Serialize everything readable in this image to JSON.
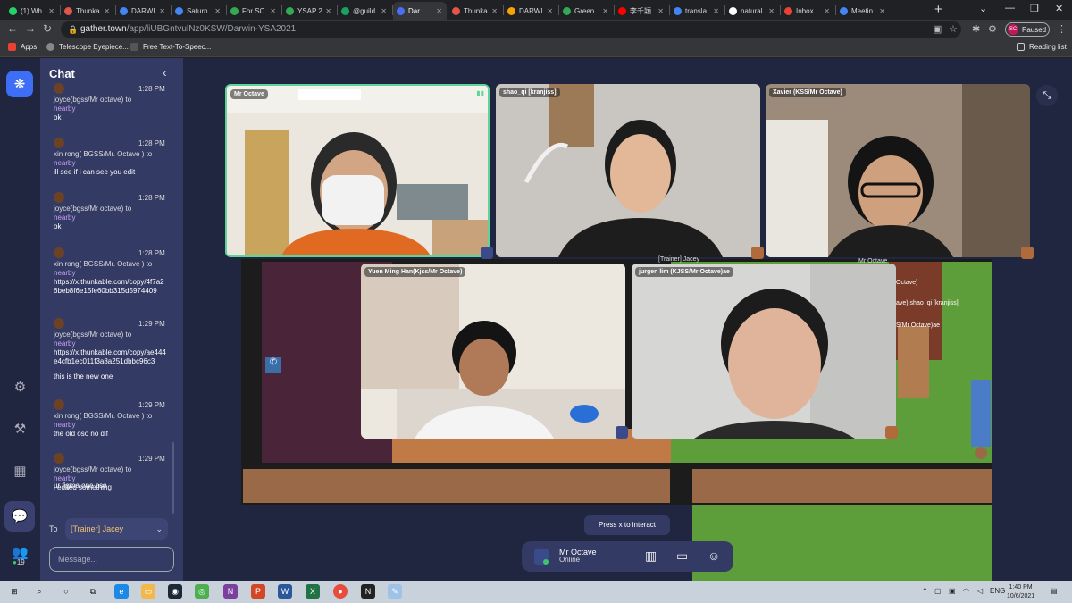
{
  "browser": {
    "tabs": [
      {
        "label": "(1) Wh",
        "color": "#25d366"
      },
      {
        "label": "Thunka",
        "color": "#e0564a"
      },
      {
        "label": "DARWI",
        "color": "#4285f4"
      },
      {
        "label": "Saturn",
        "color": "#4285f4"
      },
      {
        "label": "For SC",
        "color": "#34a853"
      },
      {
        "label": "YSAP 2",
        "color": "#34a853"
      },
      {
        "label": "@guild",
        "color": "#1aa260"
      },
      {
        "label": "Dar",
        "color": "#4a6ef5"
      },
      {
        "label": "Thunka",
        "color": "#e0564a"
      },
      {
        "label": "DARWI",
        "color": "#f4a300"
      },
      {
        "label": "Green",
        "color": "#34a853"
      },
      {
        "label": "李千穎",
        "color": "#ff0000"
      },
      {
        "label": "transla",
        "color": "#4285f4"
      },
      {
        "label": "natural",
        "color": "#ffffff"
      },
      {
        "label": "Inbox",
        "color": "#ea4335"
      },
      {
        "label": "Meetin",
        "color": "#4285f4"
      }
    ],
    "active_tab_index": 7,
    "url_host": "gather.town",
    "url_path": "/app/liUBGntvulNz0KSW/Darwin-YSA2021",
    "profile_status": "Paused",
    "profile_initials": "SC",
    "bookmarks": [
      "Apps",
      "Telescope Eyepiece...",
      "Free Text-To-Speec..."
    ],
    "reading_list": "Reading list"
  },
  "gather": {
    "chat": {
      "title": "Chat",
      "messages": [
        {
          "time": "1:28 PM",
          "sender": "joyce(bgss/Mr octave) to",
          "scope": "nearby",
          "text": "ok"
        },
        {
          "time": "1:28 PM",
          "sender": "xin rong( BGSS/Mr. Octave ) to",
          "scope": "nearby",
          "text": "ill see if i can see you edit"
        },
        {
          "time": "1:28 PM",
          "sender": "joyce(bgss/Mr octave) to",
          "scope": "nearby",
          "text": "ok"
        },
        {
          "time": "1:28 PM",
          "sender": "xin rong( BGSS/Mr. Octave ) to",
          "scope": "nearby",
          "text": "https://x.thunkable.com/copy/4f7a26beb8f6e15fe60bb315d5974409"
        },
        {
          "time": "1:29 PM",
          "sender": "joyce(bgss/Mr octave) to",
          "scope": "nearby",
          "text": "https://x.thunkable.com/copy/ae444e4cfb1ec011f3a8a251dbbc96c3"
        },
        {
          "time": "",
          "sender": "",
          "scope": "",
          "text": "this is the new one"
        },
        {
          "time": "1:29 PM",
          "sender": "xin rong( BGSS/Mr. Octave ) to",
          "scope": "nearby",
          "text": "the old oso no dif"
        },
        {
          "time": "1:29 PM",
          "sender": "joyce(bgss/Mr octave) to",
          "scope": "nearby",
          "text": "i edited something"
        },
        {
          "time": "",
          "sender": "",
          "scope": "",
          "text": "ur figma one oso"
        }
      ],
      "to_label": "To",
      "recipient": "[Trainer] Jacey",
      "input_placeholder": "Message..."
    },
    "nav": {
      "participants_count": "19"
    },
    "video_tiles": [
      {
        "name": "Mr Octave"
      },
      {
        "name": "shao_qi [kranjiss]"
      },
      {
        "name": "Xavier (KSS/Mr Octave)"
      },
      {
        "name": "Yuen Ming Han(Kjss/Mr Octave)"
      },
      {
        "name": "jurgen lim (KJSS/Mr Octave)ae"
      }
    ],
    "map_labels": [
      "[Trainer] Jacey",
      "Mr Octave",
      "Octave)",
      "ave) shao_qi [kranjiss]",
      "S/Mr Octave)ae"
    ],
    "interact_hint": "Press x to interact",
    "user": {
      "name": "Mr Octave",
      "status": "Online"
    }
  },
  "taskbar": {
    "time": "1:40 PM",
    "date": "10/6/2021",
    "lang": "ENG"
  }
}
